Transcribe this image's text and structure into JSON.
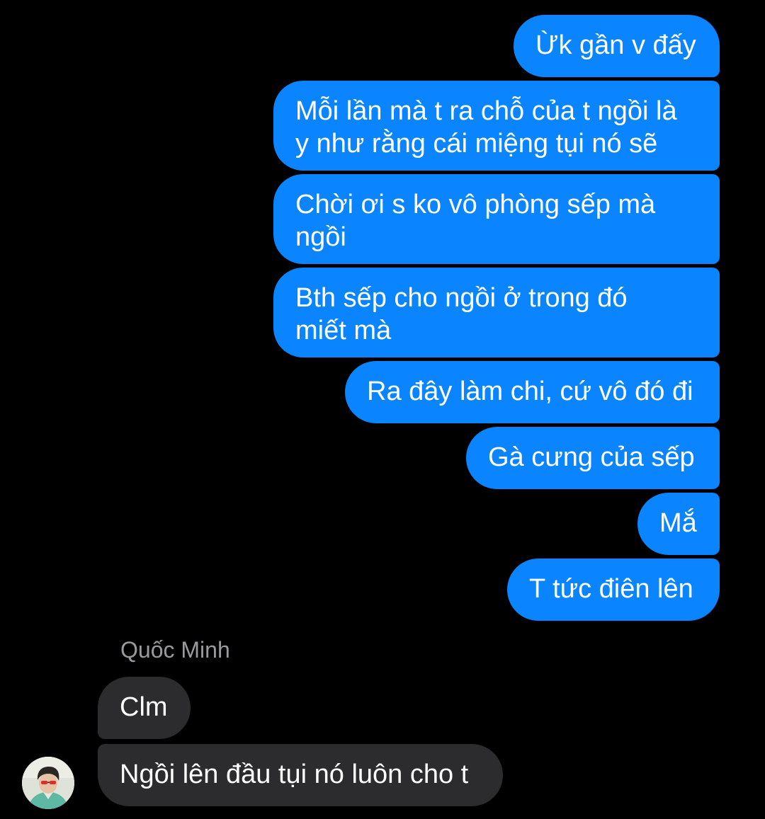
{
  "conversation": {
    "sent_messages": [
      {
        "text": "Ừk gần v đấy"
      },
      {
        "text": "Mỗi lần mà t ra chỗ của t ngồi là\ny như rằng cái miệng tụi nó sẽ"
      },
      {
        "text": "Chời ơi s ko vô phòng sếp mà\nngồi"
      },
      {
        "text": "Bth sếp cho ngồi ở trong đó\nmiết mà"
      },
      {
        "text": "Ra đây làm chi, cứ vô đó đi"
      },
      {
        "text": "Gà cưng của sếp"
      },
      {
        "text": "Mắ"
      },
      {
        "text": "T tức điên lên"
      }
    ],
    "sender_name": "Quốc Minh",
    "received_messages": [
      {
        "text": "Clm"
      },
      {
        "text": "Ngồi lên đầu tụi nó luôn cho t"
      }
    ],
    "avatar_icon": "user-avatar-photo"
  },
  "colors": {
    "background": "#000000",
    "sent_bubble": "#0a84ff",
    "received_bubble": "#2c2c2e",
    "sender_name": "#9a9a9e"
  }
}
